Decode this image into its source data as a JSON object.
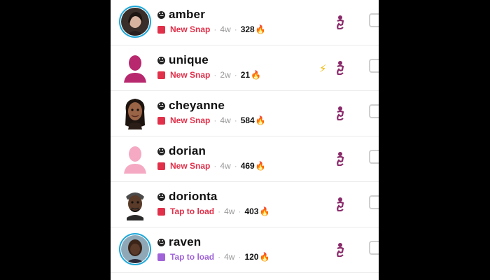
{
  "colors": {
    "new_snap": "#e0304a",
    "tap_to_load": "#e0304a",
    "purple_square": "#a064d8",
    "ring": "#1fa8d8",
    "bitmoji_magenta": "#b8286e",
    "bitmoji_pink": "#f5a9c3"
  },
  "chats": [
    {
      "name": "amber",
      "status": "New Snap",
      "status_color": "#e0304a",
      "square_color": "#e0304a",
      "age": "4w",
      "streak": "328",
      "streak_icon": "fire-icon",
      "avatar": "photo-ring",
      "flash": false
    },
    {
      "name": "unique",
      "status": "New Snap",
      "status_color": "#e0304a",
      "square_color": "#e0304a",
      "age": "2w",
      "streak": "21",
      "streak_icon": "fire-icon",
      "avatar": "silhouette-magenta",
      "flash": true
    },
    {
      "name": "cheyanne",
      "status": "New Snap",
      "status_color": "#e0304a",
      "square_color": "#e0304a",
      "age": "4w",
      "streak": "584",
      "streak_icon": "fire-icon",
      "avatar": "bitmoji-girl",
      "flash": false
    },
    {
      "name": "dorian",
      "status": "New Snap",
      "status_color": "#e0304a",
      "square_color": "#e0304a",
      "age": "4w",
      "streak": "469",
      "streak_icon": "fire-icon",
      "avatar": "silhouette-pink",
      "flash": false
    },
    {
      "name": "dorionta",
      "status": "Tap to load",
      "status_color": "#e0304a",
      "square_color": "#e0304a",
      "age": "4w",
      "streak": "403",
      "streak_icon": "fire-icon",
      "avatar": "bitmoji-boy",
      "flash": false
    },
    {
      "name": "raven",
      "status": "Tap to load",
      "status_color": "#a064d8",
      "square_color": "#a064d8",
      "age": "4w",
      "streak": "120",
      "streak_icon": "fire-icon",
      "avatar": "photo-ring",
      "flash": false
    }
  ]
}
